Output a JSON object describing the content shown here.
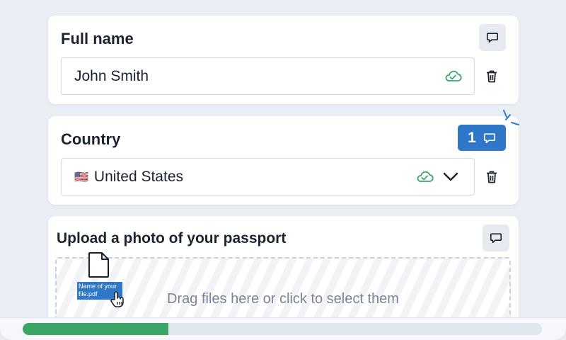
{
  "fullname": {
    "title": "Full name",
    "value": "John Smith",
    "comment_icon": "comment-icon",
    "status_icon": "cloud-check-icon",
    "delete_icon": "trash-icon"
  },
  "country": {
    "title": "Country",
    "flag": "🇺🇸",
    "value": "United States",
    "comment_count": "1",
    "status_icon": "cloud-check-icon",
    "dropdown_icon": "chevron-down-icon",
    "delete_icon": "trash-icon"
  },
  "upload": {
    "title": "Upload a photo of your passport",
    "dropzone_text": "Drag files here or click to select them",
    "dragged_file_label": "Name of your file.pdf",
    "file_icon": "file-icon",
    "cursor_icon": "hand-pointer-icon"
  },
  "progress": {
    "value": 0.28
  },
  "colors": {
    "accent_blue": "#2f77c9",
    "success_green": "#3aa564",
    "background": "#e9eef5"
  }
}
